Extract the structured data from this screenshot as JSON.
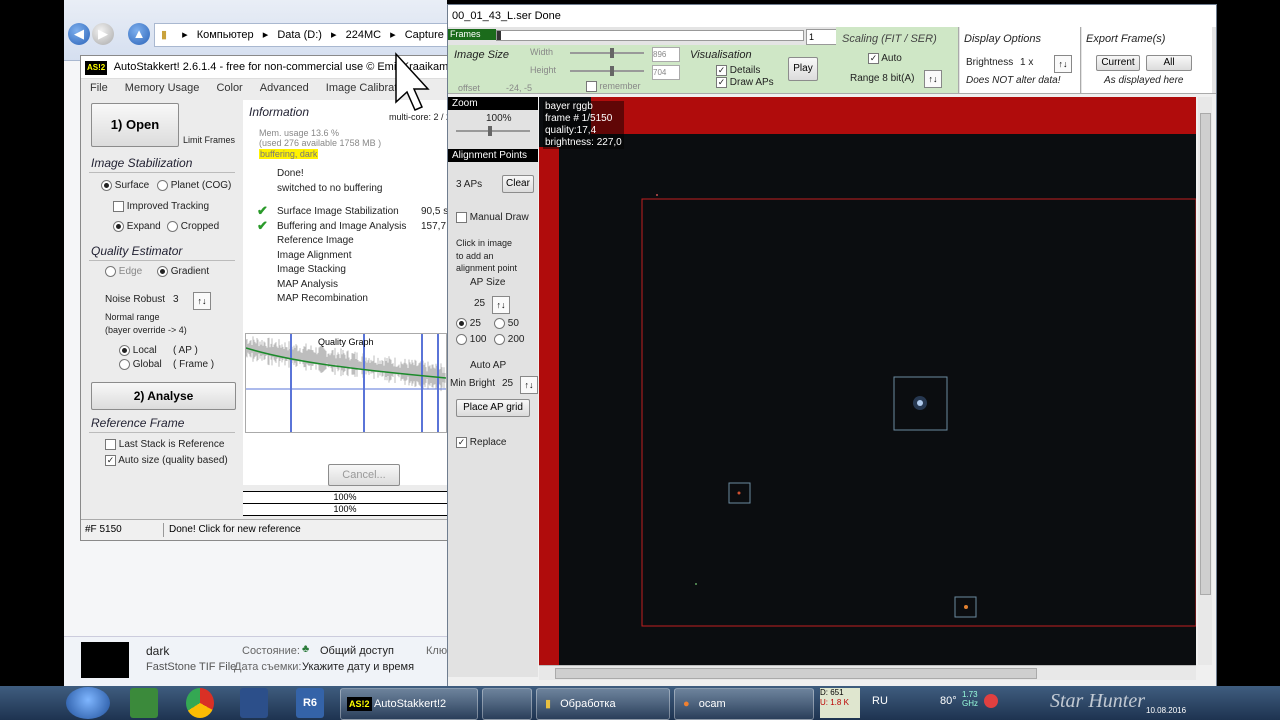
{
  "explorer": {
    "path": [
      "Компьютер",
      "Data (D:)",
      "224MC",
      "Capture"
    ],
    "details": {
      "name": "dark",
      "type": "FastStone TIF File",
      "state_label": "Состояние:",
      "state_value": "Общий доступ",
      "date_label": "Дата съемки:",
      "date_value": "Укажите дату и время",
      "extra": "Клю"
    }
  },
  "as": {
    "title": "AutoStakkert! 2.6.1.4 - free for non-commercial use © Emil Kraaikamp 20",
    "menu": [
      "File",
      "Memory Usage",
      "Color",
      "Advanced",
      "Image Calibration"
    ],
    "open": "1) Open",
    "limit_frames": "Limit Frames",
    "stab_title": "Image Stabilization",
    "surface": "Surface",
    "planet": "Planet (COG)",
    "improved": "Improved Tracking",
    "expand": "Expand",
    "cropped": "Cropped",
    "qe_title": "Quality Estimator",
    "edge": "Edge",
    "gradient": "Gradient",
    "noise_label": "Noise Robust",
    "noise_value": "3",
    "normal_range": "Normal range",
    "bayer_override": "(bayer override -> 4)",
    "local": "Local",
    "local_ap": "( AP )",
    "global": "Global",
    "global_frame": "( Frame )",
    "analyse": "2) Analyse",
    "ref_title": "Reference Frame",
    "last_stack": "Last Stack is Reference",
    "auto_size": "Auto size (quality based)",
    "info_title": "Information",
    "multicore": "multi-core: 2 / 2",
    "mem1": "Mem. usage 13.6 %",
    "mem2": "(used 276 available 1758 MB )",
    "buffering": "buffering, dark",
    "done": "Done!",
    "switched": "switched to no buffering",
    "steps": [
      {
        "label": "Surface Image Stabilization",
        "time": "90,5 s",
        "done": true
      },
      {
        "label": "Buffering and Image Analysis",
        "time": "157,7",
        "done": true
      },
      {
        "label": "Reference Image",
        "time": "",
        "done": false
      },
      {
        "label": "Image Alignment",
        "time": "",
        "done": false
      },
      {
        "label": "Image Stacking",
        "time": "",
        "done": false
      },
      {
        "label": "MAP Analysis",
        "time": "",
        "done": false
      },
      {
        "label": "MAP Recombination",
        "time": "",
        "done": false
      }
    ],
    "quality_graph": "Quality Graph",
    "cancel": "Cancel...",
    "progress1": "100%",
    "progress2": "100%",
    "status_frames": "#F 5150",
    "status_msg": "Done! Click for new reference"
  },
  "ser": {
    "title": "00_01_43_L.ser  Done",
    "frames_label": "Frames",
    "frame_value": "1",
    "image_size": "Image Size",
    "width_label": "Width",
    "width_value": "896",
    "height_label": "Height",
    "height_value": "704",
    "offset_label": "offset",
    "offset_value": "-24, -5",
    "remember": "remember",
    "visualisation": "Visualisation",
    "details": "Details",
    "draw_aps": "Draw APs",
    "play": "Play",
    "scaling_title": "Scaling (FIT / SER)",
    "auto": "Auto",
    "range": "Range 8 bit(A)",
    "display_title": "Display Options",
    "brightness_label": "Brightness",
    "brightness_value": "1 x",
    "not_alter": "Does NOT alter data!",
    "export_title": "Export Frame(s)",
    "current": "Current",
    "all": "All",
    "as_displayed": "As displayed here",
    "zoom_head": "Zoom",
    "zoom_value": "100%",
    "ap_head": "Alignment Points",
    "ap_count": "3 APs",
    "clear": "Clear",
    "manual_draw": "Manual Draw",
    "click_hint1": "Click in image",
    "click_hint2": "to add an",
    "click_hint3": "alignment point",
    "ap_size_title": "AP Size",
    "ap_size_value": "25",
    "ap_opts": [
      "25",
      "50",
      "100",
      "200"
    ],
    "auto_ap": "Auto AP",
    "min_bright_label": "Min Bright",
    "min_bright_value": "25",
    "place_grid": "Place AP grid",
    "replace": "Replace",
    "overlay": [
      "bayer rggb",
      "frame # 1/5150",
      "quality:17,4",
      "brightness: 227,0"
    ]
  },
  "taskbar": {
    "apps": [
      "AutoStakkert!2",
      "Обработка",
      "ocam"
    ],
    "lang": "RU",
    "disk_d": "D: 651",
    "disk_u": "U: 1.8 K",
    "temp": "80°",
    "freq": "1.73 GHz",
    "speed": "0.74 K/c",
    "date": "10.08.2016",
    "watermark": "Star Hunter"
  }
}
